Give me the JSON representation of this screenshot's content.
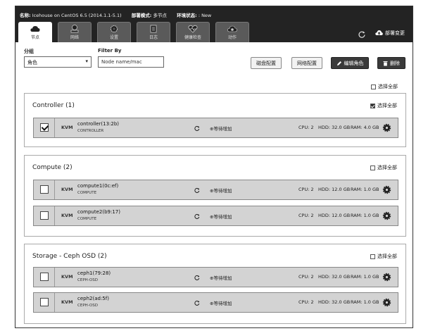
{
  "header": {
    "name_label": "名称:",
    "name_value": "Icehouse on CentOS 6.5 (2014.1.1-5.1)",
    "mode_label": "部署模式:",
    "mode_value": "多节点",
    "status_label": "环境状态:",
    "status_value": ": New",
    "deploy_label": "部署变更"
  },
  "tabs": [
    {
      "label": "节点",
      "icon": "cloud-icon",
      "active": true
    },
    {
      "label": "网络",
      "icon": "network-icon",
      "active": false
    },
    {
      "label": "设置",
      "icon": "gear-icon",
      "active": false
    },
    {
      "label": "日志",
      "icon": "log-icon",
      "active": false
    },
    {
      "label": "健康检查",
      "icon": "heart-icon",
      "active": false
    },
    {
      "label": "动作",
      "icon": "actions-icon",
      "active": false
    }
  ],
  "filters": {
    "group_label": "分组",
    "group_value": "角色",
    "filter_label": "Filter By",
    "filter_value": "Node name/mac"
  },
  "toolbar": {
    "disk_label": "磁盘配置",
    "network_label": "网络配置",
    "edit_label": "编辑角色",
    "delete_label": "删除",
    "select_all_label": "选择全部"
  },
  "groups": [
    {
      "title": "Controller (1)",
      "select_all_label": "选择全部",
      "select_all_checked": true,
      "nodes": [
        {
          "checked": true,
          "kvm": "KVM",
          "name": "controller(13:2b)",
          "role": "CONTROLLER",
          "status": "等待增加",
          "cpu": "CPU: 2",
          "hdd": "HDD: 32.0 GB",
          "ram": "RAM: 4.0 GB"
        }
      ]
    },
    {
      "title": "Compute (2)",
      "select_all_label": "选择全部",
      "select_all_checked": false,
      "nodes": [
        {
          "checked": false,
          "kvm": "KVM",
          "name": "compute1(0c:ef)",
          "role": "COMPUTE",
          "status": "等待增加",
          "cpu": "CPU: 2",
          "hdd": "HDD: 12.0 GB",
          "ram": "RAM: 1.0 GB"
        },
        {
          "checked": false,
          "kvm": "KVM",
          "name": "compute2(b9:17)",
          "role": "COMPUTE",
          "status": "等待增加",
          "cpu": "CPU: 2",
          "hdd": "HDD: 12.0 GB",
          "ram": "RAM: 1.0 GB"
        }
      ]
    },
    {
      "title": "Storage - Ceph OSD (2)",
      "select_all_label": "选择全部",
      "select_all_checked": false,
      "nodes": [
        {
          "checked": false,
          "kvm": "KVM",
          "name": "ceph1(79:28)",
          "role": "CEPH-OSD",
          "status": "等待增加",
          "cpu": "CPU: 2",
          "hdd": "HDD: 32.0 GB",
          "ram": "RAM: 1.0 GB"
        },
        {
          "checked": false,
          "kvm": "KVM",
          "name": "ceph2(ad:5f)",
          "role": "CEPH-OSD",
          "status": "等待增加",
          "cpu": "CPU: 2",
          "hdd": "HDD: 32.0 GB",
          "ram": "RAM: 1.0 GB"
        }
      ]
    }
  ]
}
